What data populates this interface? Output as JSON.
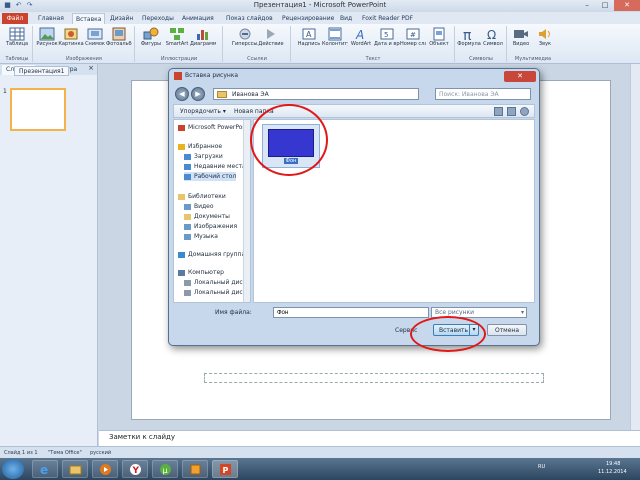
{
  "window": {
    "title": "Презентация1 - Microsoft PowerPoint",
    "buttons": {
      "minimize": "–",
      "maximize": "□",
      "close": "✕"
    }
  },
  "ribbon": {
    "tabs": [
      "Файл",
      "Главная",
      "Вставка",
      "Дизайн",
      "Переходы",
      "Анимация",
      "Показ слайдов",
      "Рецензирование",
      "Вид",
      "Foxit Reader PDF"
    ],
    "active_tab": "Вставка",
    "buttons": [
      {
        "label": "Таблица",
        "icon": "table-icon"
      },
      {
        "label": "Рисунок",
        "icon": "picture-icon"
      },
      {
        "label": "Картинка",
        "icon": "clipart-icon"
      },
      {
        "label": "Снимок",
        "icon": "screenshot-icon"
      },
      {
        "label": "Фотоальбом",
        "icon": "photo-album-icon"
      },
      {
        "label": "Фигуры",
        "icon": "shapes-icon"
      },
      {
        "label": "SmartArt",
        "icon": "smartart-icon"
      },
      {
        "label": "Диаграмма",
        "icon": "chart-icon"
      },
      {
        "label": "Гиперссылка",
        "icon": "hyperlink-icon"
      },
      {
        "label": "Действие",
        "icon": "action-icon"
      },
      {
        "label": "Надпись",
        "icon": "textbox-icon"
      },
      {
        "label": "Колонтитулы",
        "icon": "header-footer-icon"
      },
      {
        "label": "WordArt",
        "icon": "wordart-icon"
      },
      {
        "label": "Дата и время",
        "icon": "date-time-icon"
      },
      {
        "label": "Номер слайда",
        "icon": "slide-number-icon"
      },
      {
        "label": "Объект",
        "icon": "object-icon"
      },
      {
        "label": "Формула",
        "icon": "equation-icon"
      },
      {
        "label": "Символ",
        "icon": "symbol-icon"
      },
      {
        "label": "Видео",
        "icon": "video-icon"
      },
      {
        "label": "Звук",
        "icon": "sound-icon"
      }
    ],
    "groups": [
      "Таблицы",
      "Изображения",
      "Иллюстрации",
      "Ссылки",
      "Текст",
      "Символы",
      "Мультимедиа"
    ]
  },
  "slides_pane": {
    "tabs": [
      "Слайды",
      "Структура"
    ],
    "close": "×",
    "thumb_number": "1"
  },
  "doc_tab": "Презентация1",
  "notes": "Заметки к слайду",
  "statusbar": [
    "Слайд 1 из 1",
    "\"Тема Office\"",
    "русский"
  ],
  "dialog": {
    "title": "Вставка рисунка",
    "close": "✕",
    "back": "◀",
    "forward": "▶",
    "address": "Иванова ЭА",
    "search_placeholder": "Поиск: Иванова ЭА",
    "toolbar": {
      "organize": "Упорядочить ▾",
      "new_folder": "Новая папка"
    },
    "nav_items": [
      {
        "label": "Microsoft PowerPoint",
        "icon": "powerpoint-icon",
        "color": "#c9432e"
      },
      {
        "label": "Избранное",
        "icon": "star-icon",
        "color": "#e8b320"
      },
      {
        "label": "Загрузки",
        "icon": "downloads-icon",
        "color": "#4a8ad0"
      },
      {
        "label": "Недавние места",
        "icon": "recent-places-icon",
        "color": "#4a8ad0"
      },
      {
        "label": "Рабочий стол",
        "icon": "desktop-icon",
        "color": "#4a8ad0"
      },
      {
        "label": "Библиотеки",
        "icon": "libraries-icon",
        "color": "#e9c46a"
      },
      {
        "label": "Видео",
        "icon": "video-library-icon",
        "color": "#6a9ac8"
      },
      {
        "label": "Документы",
        "icon": "documents-icon",
        "color": "#e9c46a"
      },
      {
        "label": "Изображения",
        "icon": "pictures-icon",
        "color": "#6a9ac8"
      },
      {
        "label": "Музыка",
        "icon": "music-icon",
        "color": "#6a9ac8"
      },
      {
        "label": "Домашняя группа",
        "icon": "homegroup-icon",
        "color": "#3a8ad0"
      },
      {
        "label": "Компьютер",
        "icon": "computer-icon",
        "color": "#5a7aa0"
      },
      {
        "label": "Локальный диск",
        "icon": "local-disk-icon",
        "color": "#8a9aaa"
      },
      {
        "label": "Локальный диск",
        "icon": "local-disk-icon",
        "color": "#8a9aaa"
      }
    ],
    "file": {
      "name": "Фон",
      "thumb_color": "#3636d0"
    },
    "filename_label": "Имя файла:",
    "filename_value": "Фон",
    "filetype": "Все рисунки",
    "service": "Сервис",
    "insert": "Вставить",
    "cancel": "Отмена"
  },
  "taskbar": {
    "apps": [
      "internet-explorer-icon",
      "explorer-icon",
      "media-player-icon",
      "yandex-icon",
      "utorrent-icon",
      "paint-icon",
      "powerpoint-icon"
    ],
    "lang": "RU",
    "time": "19:48",
    "date": "11.12.2014"
  },
  "accent": {
    "annotation": "#e01818",
    "file_tab": "#c9432e"
  }
}
